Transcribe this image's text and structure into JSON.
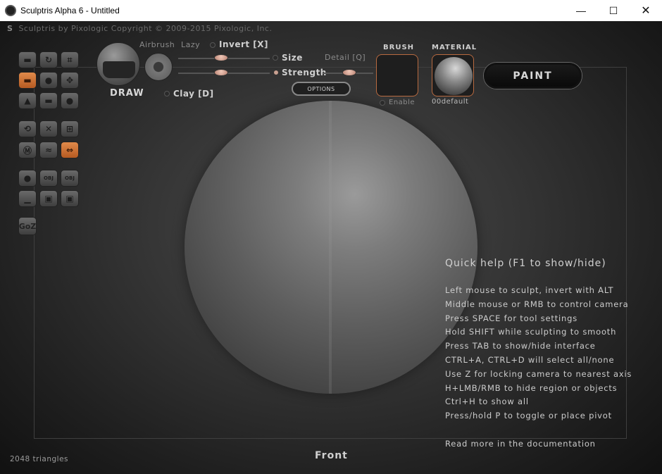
{
  "window": {
    "title": "Sculptris Alpha 6 - Untitled",
    "minimize": "—",
    "maximize": "☐",
    "close": "✕"
  },
  "header": {
    "logo": "S",
    "copyright": "Sculptris by Pixologic   Copyright © 2009-2015 Pixologic, Inc."
  },
  "toolbar": {
    "goz": "GoZ",
    "obj": "OBJ"
  },
  "tool": {
    "name": "DRAW",
    "airbrush": "Airbrush",
    "lazy": "Lazy",
    "invert": "Invert [X]",
    "clay": "Clay [D]",
    "size": "Size",
    "strength": "Strength",
    "detail": "Detail [Q]",
    "options": "OPTIONS"
  },
  "brush": {
    "header": "BRUSH",
    "enable": "Enable"
  },
  "material": {
    "header": "MATERIAL",
    "name": "00default"
  },
  "paint_button": "PAINT",
  "quick_help": {
    "title": "Quick help (F1 to show/hide)",
    "lines": [
      "Left mouse to sculpt, invert with ALT",
      "Middle mouse or RMB to control camera",
      "Press SPACE for tool settings",
      "Hold SHIFT while sculpting to smooth",
      "Press TAB to show/hide interface",
      "CTRL+A, CTRL+D will select all/none",
      "Use Z for locking camera to nearest axis",
      "H+LMB/RMB to hide region or objects",
      "Ctrl+H to show all",
      "Press/hold P to toggle or place pivot",
      "Read more in the documentation"
    ]
  },
  "status": {
    "triangles": "2048 triangles",
    "view": "Front"
  },
  "colors": {
    "accent_orange": "#d07a3e",
    "background": "#2a2a2a"
  }
}
